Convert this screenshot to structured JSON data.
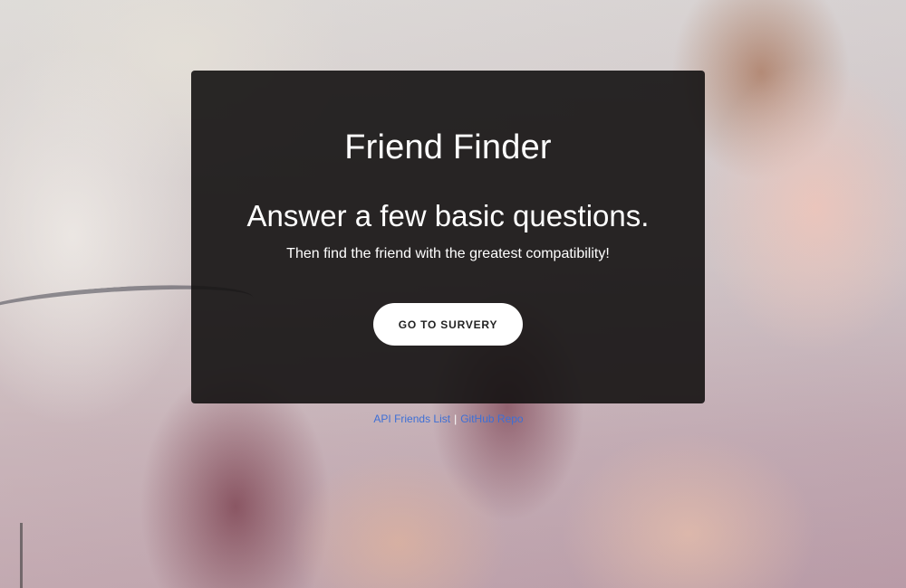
{
  "hero": {
    "title": "Friend Finder",
    "headline": "Answer a few basic questions.",
    "subtitle": "Then find the friend with the greatest compatibility!",
    "cta_label": "GO TO SURVERY"
  },
  "footer": {
    "api_link_label": "API Friends List",
    "separator": "|",
    "github_link_label": "GitHub Repo"
  },
  "colors": {
    "panel_bg": "#141212",
    "link": "#3d6fd6",
    "button_bg": "#ffffff"
  }
}
